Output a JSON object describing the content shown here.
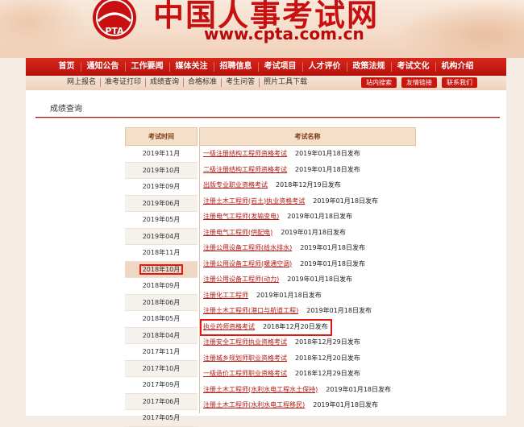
{
  "site": {
    "title": "中国人事考试网",
    "url": "www.cpta.com.cn",
    "logo_text": "PTA"
  },
  "nav": [
    "首页",
    "通知公告",
    "工作要闻",
    "媒体关注",
    "招聘信息",
    "考试项目",
    "人才评价",
    "政策法规",
    "考试文化",
    "机构介绍"
  ],
  "subnav": {
    "left": [
      "网上报名",
      "准考证打印",
      "成绩查询",
      "合格标准",
      "考生问答",
      "照片工具下载"
    ],
    "right": [
      "站内搜索",
      "友情链接",
      "联系我们"
    ]
  },
  "section_title": "成绩查询",
  "table": {
    "left_header": "考试时间",
    "right_header": "考试名称",
    "dates": [
      "2019年11月",
      "2019年10月",
      "2019年09月",
      "2019年06月",
      "2019年05月",
      "2019年04月",
      "2018年11月",
      "2018年10月",
      "2018年09月",
      "2018年06月",
      "2018年05月",
      "2018年04月",
      "2017年11月",
      "2017年10月",
      "2017年09月",
      "2017年06月",
      "2017年05月"
    ],
    "selected_date_index": 7,
    "exams": [
      {
        "name": "一级注册结构工程师资格考试",
        "date": "2019年01月18日发布"
      },
      {
        "name": "二级注册结构工程师资格考试",
        "date": "2019年01月18日发布"
      },
      {
        "name": "出版专业职业资格考试",
        "date": "2018年12月19日发布"
      },
      {
        "name": "注册土木工程师(岩土)执业资格考试",
        "date": "2019年01月18日发布"
      },
      {
        "name": "注册电气工程师(发输变电)",
        "date": "2019年01月18日发布"
      },
      {
        "name": "注册电气工程师(供配电)",
        "date": "2019年01月18日发布"
      },
      {
        "name": "注册公用设备工程师(给水排水)",
        "date": "2019年01月18日发布"
      },
      {
        "name": "注册公用设备工程师(暖通空调)",
        "date": "2019年01月18日发布"
      },
      {
        "name": "注册公用设备工程师(动力)",
        "date": "2019年01月18日发布"
      },
      {
        "name": "注册化工工程师",
        "date": "2019年01月18日发布"
      },
      {
        "name": "注册土木工程师(港口与航道工程)",
        "date": "2019年01月18日发布"
      },
      {
        "name": "执业药师资格考试",
        "date": "2018年12月20日发布"
      },
      {
        "name": "注册安全工程师执业资格考试",
        "date": "2018年12月29日发布"
      },
      {
        "name": "注册城乡规划师职业资格考试",
        "date": "2018年12月20日发布"
      },
      {
        "name": "一级造价工程师职业资格考试",
        "date": "2018年12月29日发布"
      },
      {
        "name": "注册土木工程师(水利水电工程水土保持)",
        "date": "2019年01月18日发布"
      },
      {
        "name": "注册土木工程师(水利水电工程移民)",
        "date": "2019年01月18日发布"
      }
    ],
    "highlighted_exam_index": 11
  },
  "colors": {
    "brand_red": "#c81010",
    "highlight_box": "#e01a10",
    "header_bg": "#f6dfc8"
  }
}
